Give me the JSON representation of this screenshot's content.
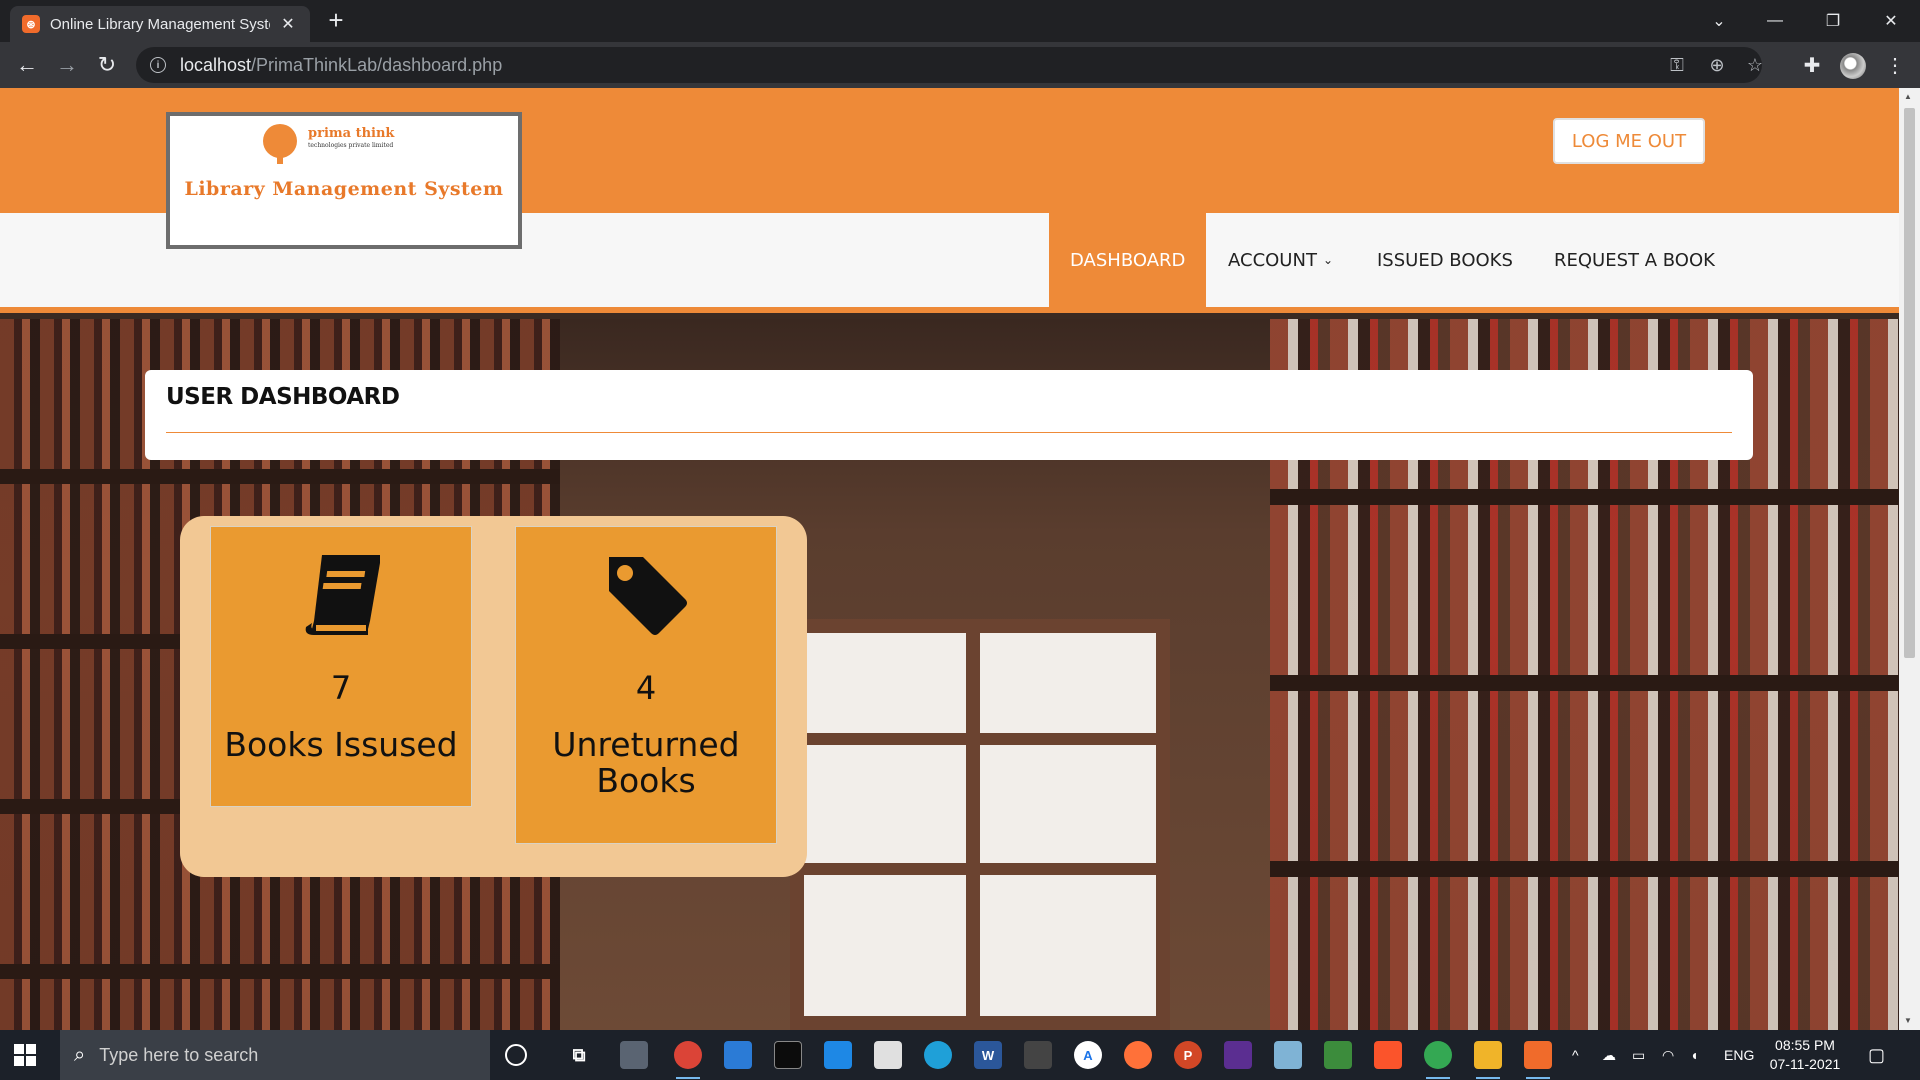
{
  "browser": {
    "tab_title": "Online Library Management System",
    "tab_favicon": "xampp-icon",
    "url_host": "localhost",
    "url_path": "/PrimaThinkLab/dashboard.php"
  },
  "site": {
    "logo": {
      "brand": "prima think",
      "brand_sub": "technologies private limited",
      "title": "Library Management System"
    },
    "logout_label": "LOG ME OUT",
    "nav": {
      "dashboard": "DASHBOARD",
      "account": "ACCOUNT",
      "issued_books": "ISSUED BOOKS",
      "request_book": "REQUEST A BOOK"
    },
    "dashboard_title": "USER DASHBOARD",
    "stats": [
      {
        "icon": "book-icon",
        "value": "7",
        "label": "Books Issused"
      },
      {
        "icon": "tag-icon",
        "value": "4",
        "label": "Unreturned Books"
      }
    ],
    "colors": {
      "accent": "#ee8a38",
      "stat_box": "#ea9a30",
      "stat_panel": "#f2c894"
    }
  },
  "taskbar": {
    "search_placeholder": "Type here to search",
    "language": "ENG",
    "time": "08:55 PM",
    "date": "07-11-2021"
  }
}
